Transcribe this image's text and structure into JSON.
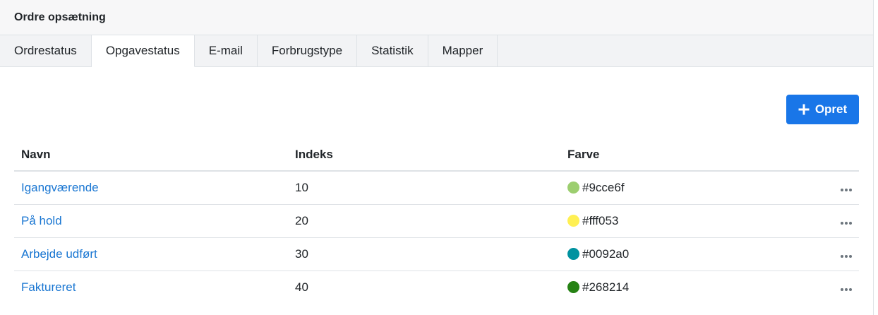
{
  "header": {
    "title": "Ordre opsætning"
  },
  "tabs": [
    {
      "label": "Ordrestatus"
    },
    {
      "label": "Opgavestatus"
    },
    {
      "label": "E-mail"
    },
    {
      "label": "Forbrugstype"
    },
    {
      "label": "Statistik"
    },
    {
      "label": "Mapper"
    }
  ],
  "active_tab": "Opgavestatus",
  "toolbar": {
    "create_label": "Opret",
    "create_icon": "plus-icon",
    "button_color": "#1976e8"
  },
  "table": {
    "columns": [
      "Navn",
      "Indeks",
      "Farve"
    ],
    "rows": [
      {
        "name": "Igangværende",
        "index": "10",
        "color": "#9cce6f"
      },
      {
        "name": "På hold",
        "index": "20",
        "color": "#fff053"
      },
      {
        "name": "Arbejde udført",
        "index": "30",
        "color": "#0092a0"
      },
      {
        "name": "Faktureret",
        "index": "40",
        "color": "#268214"
      }
    ],
    "row_action_icon": "more-horizontal-icon"
  }
}
